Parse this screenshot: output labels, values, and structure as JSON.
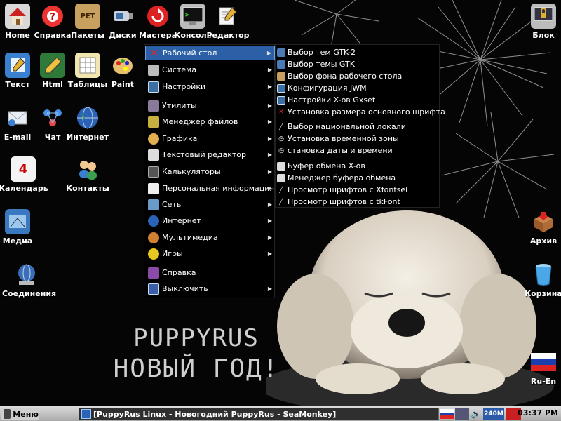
{
  "desktop_icons": {
    "home": "Home",
    "help": "Справка",
    "packages": "Пакеты",
    "disks": "Диски",
    "wizards": "Мастера",
    "console": "Консоль",
    "editor": "Редактор",
    "lock": "Блок",
    "text": "Текст",
    "html": "Html",
    "tables": "Таблицы",
    "paint": "Paint",
    "email": "E-mail",
    "chat": "Чат",
    "internet": "Интернет",
    "calendar": "Календарь",
    "contacts": "Контакты",
    "media": "Медиа",
    "connections": "Соединения",
    "archive": "Архив",
    "trash": "Корзина",
    "lang": "Ru-En",
    "pet_badge": "PET",
    "calendar_day": "4"
  },
  "wallpaper": {
    "line1": "PUPPYRUS",
    "line2": "НОВЫЙ ГОД!"
  },
  "main_menu": {
    "items": [
      {
        "label": "Рабочий стол",
        "icon": "desktop-icon",
        "submenu": true
      },
      {
        "label": "Система",
        "icon": "system-icon",
        "submenu": true
      },
      {
        "label": "Настройки",
        "icon": "settings-icon",
        "submenu": true
      },
      {
        "label": "Утилиты",
        "icon": "utilities-icon",
        "submenu": true
      },
      {
        "label": "Менеджер файлов",
        "icon": "file-manager-icon",
        "submenu": true
      },
      {
        "label": "Графика",
        "icon": "graphics-icon",
        "submenu": true
      },
      {
        "label": "Текстовый редактор",
        "icon": "text-editor-icon",
        "submenu": true
      },
      {
        "label": "Калькуляторы",
        "icon": "calculator-icon",
        "submenu": true
      },
      {
        "label": "Персональная информация",
        "icon": "personal-info-icon",
        "submenu": true
      },
      {
        "label": "Сеть",
        "icon": "network-icon",
        "submenu": true
      },
      {
        "label": "Интернет",
        "icon": "internet-icon",
        "submenu": true
      },
      {
        "label": "Мультимедиа",
        "icon": "multimedia-icon",
        "submenu": true
      },
      {
        "label": "Игры",
        "icon": "games-icon",
        "submenu": true
      },
      {
        "label": "Справка",
        "icon": "help-book-icon",
        "submenu": false
      },
      {
        "label": "Выключить",
        "icon": "shutdown-icon",
        "submenu": true
      }
    ],
    "arrow": "▶"
  },
  "submenu": {
    "items": [
      "Выбор тем GTK-2",
      "Выбор темы GTK",
      "Выбор фона рабочего стола",
      "Конфигурация JWM",
      "Настройки X-ов Gxset",
      "Установка размера основного шрифта",
      "Выбор национальной локали",
      "Установка временной зоны",
      "становка даты и времени",
      "Буфер обмена X-ов",
      "Менеджер буфера обмена",
      "Просмотр шрифтов с Xfontsel",
      "Просмотр шрифтов с tkFont"
    ]
  },
  "taskbar": {
    "menu_label": "Меню",
    "task_title": "[PuppyRus Linux - Новогодний PuppyRus - SeaMonkey]",
    "cpu_label": "240M",
    "clock": "03:37 PM"
  },
  "colors": {
    "menu_highlight": "#2b5fa6",
    "taskbar": "#c0c0c0",
    "background": "#000000"
  }
}
